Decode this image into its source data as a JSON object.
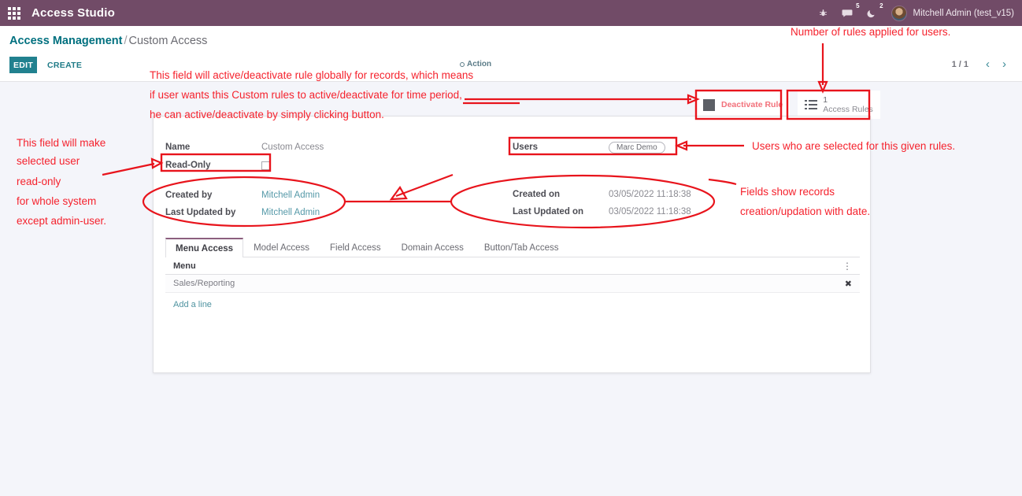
{
  "navbar": {
    "apps_icon": "apps-grid-icon",
    "brand": "Access Studio",
    "icons": [
      {
        "name": "bug-icon",
        "glyph": "✶",
        "badge": ""
      },
      {
        "name": "messages-icon",
        "glyph": "●",
        "badge": "5"
      },
      {
        "name": "activities-icon",
        "glyph": "☾",
        "badge": "2"
      }
    ],
    "user": "Mitchell Admin (test_v15)"
  },
  "control_panel": {
    "breadcrumb_root": "Access Management",
    "breadcrumb_sep": "/",
    "breadcrumb_current": "Custom Access",
    "edit_label": "EDIT",
    "create_label": "CREATE",
    "action_label": "Action",
    "pager_count": "1 / 1",
    "pager_prev": "‹",
    "pager_next": "›"
  },
  "stat_buttons": {
    "deactivate": {
      "label": "Deactivate Rule",
      "icon": "toggle-square-icon"
    },
    "access_rules": {
      "value": "1",
      "label": "Access Rules",
      "icon": "list-icon"
    }
  },
  "form": {
    "left_fields": [
      {
        "label": "Name",
        "value": "Custom Access",
        "type": "text"
      },
      {
        "label": "Read-Only",
        "value": "",
        "type": "checkbox"
      }
    ],
    "right_fields": [
      {
        "label": "Users",
        "value": "Marc Demo",
        "type": "tag"
      }
    ],
    "left_meta": [
      {
        "label": "Created by",
        "value": "Mitchell Admin"
      },
      {
        "label": "Last Updated by",
        "value": "Mitchell Admin"
      }
    ],
    "right_meta": [
      {
        "label": "Created on",
        "value": "03/05/2022 11:18:38"
      },
      {
        "label": "Last Updated on",
        "value": "03/05/2022 11:18:38"
      }
    ]
  },
  "notebook": {
    "tabs": [
      {
        "label": "Menu Access",
        "active": true
      },
      {
        "label": "Model Access",
        "active": false
      },
      {
        "label": "Field Access",
        "active": false
      },
      {
        "label": "Domain Access",
        "active": false
      },
      {
        "label": "Button/Tab Access",
        "active": false
      }
    ],
    "table": {
      "column": "Menu",
      "options_icon": "kebab-menu-icon",
      "rows": [
        {
          "menu": "Sales/Reporting",
          "delete_icon": "✖"
        }
      ],
      "add_line": "Add a line"
    }
  },
  "annotations": {
    "top_right": "Number of rules applied for users.",
    "deactivate_block": [
      "This field will active/deactivate rule globally for records, which means",
      "if user wants this Custom rules to active/deactivate for time period,",
      "he can active/deactivate by simply clicking button."
    ],
    "read_only_block": [
      "This field will make",
      "selected user",
      "read-only",
      "for whole system",
      "except admin-user."
    ],
    "users": "Users who are selected for this given rules.",
    "meta_block": [
      "Fields show records",
      "creation/updation with date."
    ]
  },
  "colors": {
    "navbar": "#714b67",
    "accent_teal": "#21818f",
    "annotation_red": "#f5222d",
    "page_bg": "#f4f5fa"
  }
}
